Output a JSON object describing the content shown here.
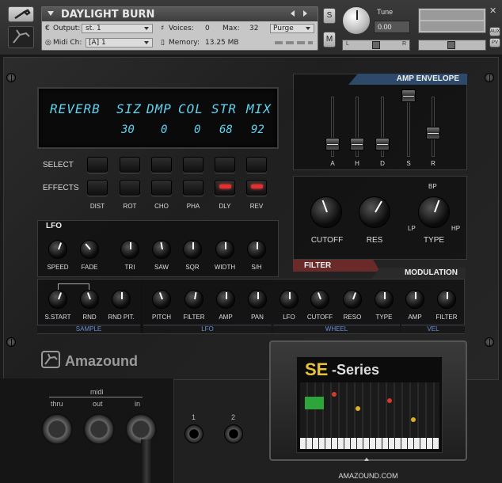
{
  "header": {
    "instrument_name": "DAYLIGHT BURN",
    "output_label": "Output:",
    "output_value": "st. 1",
    "voices_label": "Voices:",
    "voices_value": "0",
    "max_label": "Max:",
    "max_value": "32",
    "purge_label": "Purge",
    "midi_label": "Midi Ch:",
    "midi_value": "[A]  1",
    "memory_label": "Memory:",
    "memory_value": "13.25 MB",
    "solo_label": "S",
    "mute_label": "M",
    "tune_label": "Tune",
    "tune_value": "0.00",
    "pan_left": "L",
    "pan_right": "R",
    "aux_label": "AUX",
    "pv_label": "PV"
  },
  "lcd": {
    "name": "REVERB",
    "params": [
      "SIZ",
      "DMP",
      "COL",
      "STR",
      "MIX"
    ],
    "values": [
      "30",
      "0",
      "0",
      "68",
      "92"
    ]
  },
  "select_label": "SELECT",
  "effects_label": "EFFECTS",
  "effects": [
    {
      "label": "DIST",
      "on": false
    },
    {
      "label": "ROT",
      "on": false
    },
    {
      "label": "CHO",
      "on": false
    },
    {
      "label": "PHA",
      "on": false
    },
    {
      "label": "DLY",
      "on": true
    },
    {
      "label": "REV",
      "on": true
    }
  ],
  "lfo": {
    "title": "LFO",
    "knobs": [
      "SPEED",
      "FADE",
      "TRI",
      "SAW",
      "SQR",
      "WIDTH",
      "S/H"
    ]
  },
  "amp_envelope": {
    "title": "AMP ENVELOPE",
    "faders": [
      "A",
      "H",
      "D",
      "S",
      "R"
    ],
    "levels": [
      0.15,
      0.15,
      0.15,
      1.0,
      0.35
    ]
  },
  "filter": {
    "title": "FILTER",
    "cutoff": "CUTOFF",
    "res": "RES",
    "type": "TYPE",
    "bp": "BP",
    "lp": "LP",
    "hp": "HP"
  },
  "modulation": {
    "title": "MODULATION",
    "sample_knobs": [
      "S.START",
      "RND",
      "RND PIT."
    ],
    "mod_knobs": [
      "PITCH",
      "FILTER",
      "AMP",
      "PAN",
      "LFO",
      "CUTOFF",
      "RESO",
      "TYPE",
      "AMP",
      "FILTER"
    ],
    "groups": [
      "SAMPLE",
      "LFO",
      "WHEEL",
      "VEL"
    ]
  },
  "brand": "Amazound",
  "midi": {
    "title": "midi",
    "thru": "thru",
    "out": "out",
    "in": "in"
  },
  "audio_jacks": [
    "1",
    "2"
  ],
  "cartridge": {
    "title_se": "SE",
    "title_series": "-Series"
  },
  "footer_url": "AMAZOUND.COM",
  "colors": {
    "lcd_text": "#5fd3f0",
    "led_red": "#e23030",
    "group_label": "#6a8fd0",
    "header_accent": "#2d4a6a"
  }
}
